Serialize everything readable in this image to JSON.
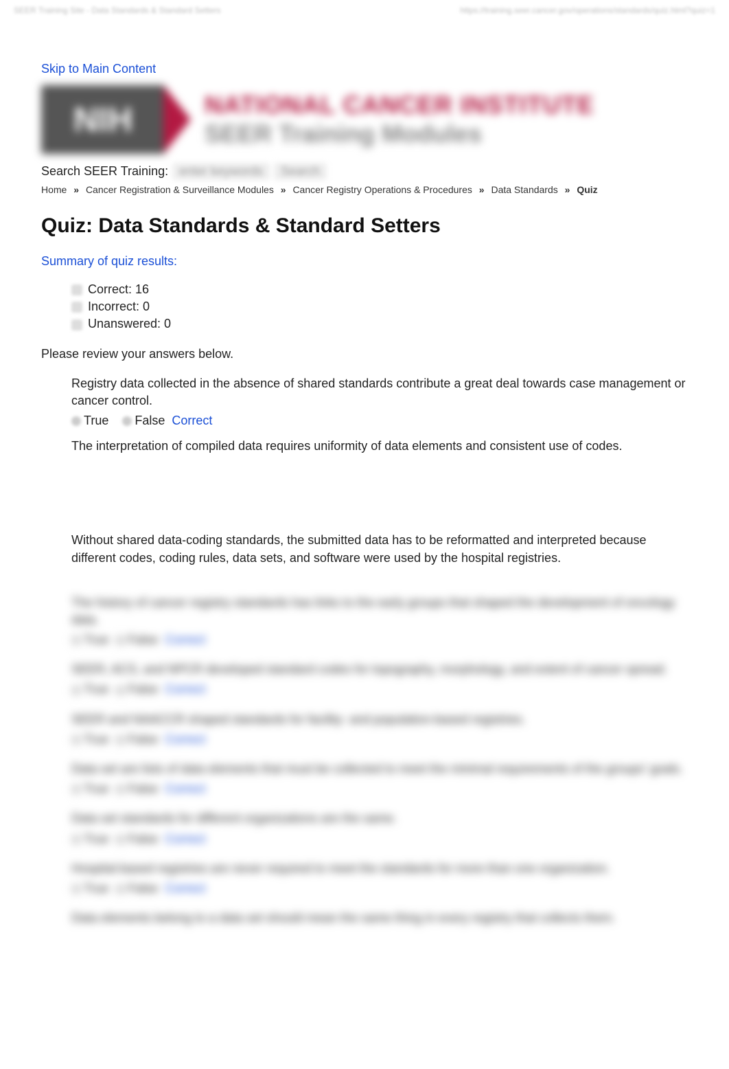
{
  "top": {
    "left": "SEER Training Site - Data Standards & Standard Setters",
    "right": "https://training.seer.cancer.gov/operations/standards/quiz.html?quiz=1"
  },
  "skip": "Skip to Main Content",
  "banner": {
    "nih": "NIH",
    "line1": "NATIONAL CANCER INSTITUTE",
    "line2": "SEER Training Modules"
  },
  "search": {
    "label": "Search SEER Training:",
    "placeholder": "enter keywords",
    "button": "Search"
  },
  "breadcrumbs": {
    "items": [
      "Home",
      "Cancer Registration & Surveillance Modules",
      "Cancer Registry Operations & Procedures",
      "Data Standards",
      "Quiz"
    ]
  },
  "title": "Quiz: Data Standards & Standard Setters",
  "summary": {
    "heading": "Summary of quiz results:",
    "correct": "Correct: 16",
    "incorrect": "Incorrect: 0",
    "unanswered": "Unanswered: 0"
  },
  "review": "Please review your answers below.",
  "opts": {
    "true": "True",
    "false": "False",
    "correct": "Correct"
  },
  "q1": "Registry data collected in the absence of shared standards contribute a great deal towards case management or cancer control.",
  "q2": "The interpretation of compiled data requires uniformity of data elements and consistent use of codes.",
  "q3": "Without shared data-coding standards, the submitted data has to be reformatted and interpreted because different codes, coding rules, data sets, and software were used by the hospital registries.",
  "blurred": {
    "q4": "The history of cancer registry standards has links to the early groups that shaped the development of oncology data.",
    "q5": "SEER, ACS, and NPCR developed standard codes for topography, morphology, and extent of cancer spread.",
    "q6": "SEER and NAACCR shaped standards for facility- and population-based registries.",
    "q7": "Data set are lists of data elements that must be collected to meet the minimal requirements of the groups' goals.",
    "q8": "Data set standards for different organizations are the same.",
    "q9": "Hospital-based registries are never required to meet the standards for more than one organization.",
    "q10": "Data elements belong to a data set should mean the same thing in every registry that collects them."
  }
}
